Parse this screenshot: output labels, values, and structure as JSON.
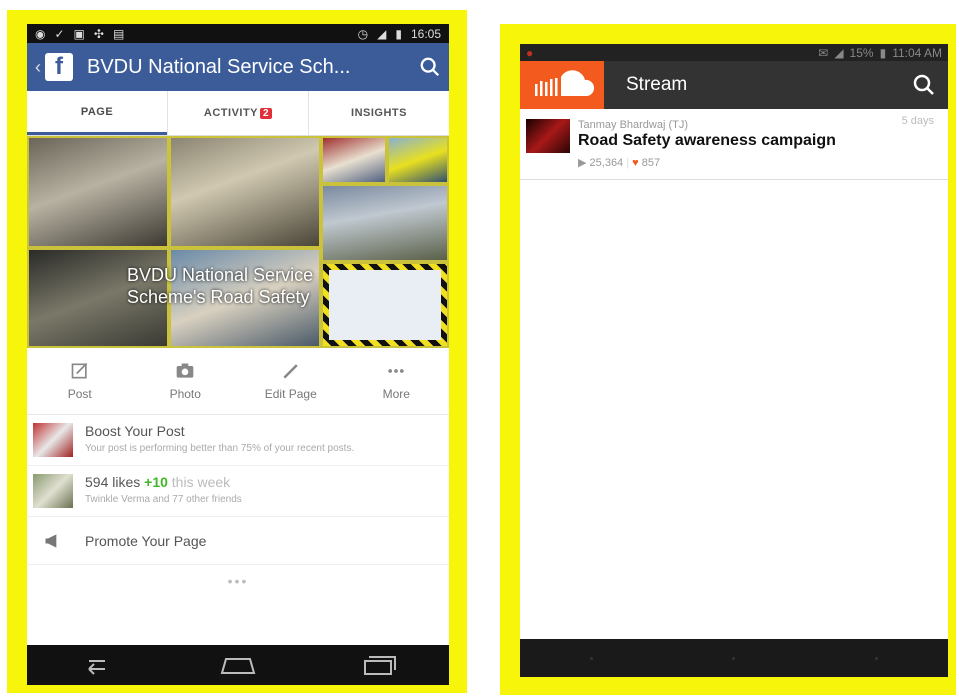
{
  "left_phone": {
    "status_bar": {
      "time": "16:05"
    },
    "header": {
      "title": "BVDU National Service Sch...",
      "search_icon": "search-icon"
    },
    "tabs": [
      {
        "label": "PAGE",
        "active": true
      },
      {
        "label": "ACTIVITY",
        "badge": "2",
        "active": false
      },
      {
        "label": "INSIGHTS",
        "active": false
      }
    ],
    "cover": {
      "overlay_text": "BVDU National Service Scheme's Road Safety"
    },
    "actions": [
      {
        "label": "Post",
        "icon": "compose-icon"
      },
      {
        "label": "Photo",
        "icon": "camera-icon"
      },
      {
        "label": "Edit Page",
        "icon": "pencil-icon"
      },
      {
        "label": "More",
        "icon": "more-dots-icon"
      }
    ],
    "boost": {
      "title": "Boost Your Post",
      "subtitle": "Your post is performing better than 75% of your recent posts."
    },
    "likes": {
      "count": "594 likes",
      "delta": "+10",
      "period": "this week",
      "friends": "Twinkle Verma and 77 other friends"
    },
    "promote": {
      "label": "Promote Your Page",
      "icon": "megaphone-icon"
    },
    "more_dots": "•••"
  },
  "right_phone": {
    "status_bar": {
      "battery": "15%",
      "time": "11:04 AM"
    },
    "header": {
      "title": "Stream",
      "logo": "soundcloud-logo",
      "search_icon": "search-icon"
    },
    "track": {
      "user": "Tanmay Bhardwaj (TJ)",
      "time": "5 days",
      "title": "Road Safety awareness campaign",
      "plays": "25,364",
      "likes": "857"
    }
  },
  "colors": {
    "frame": "#f7f50a",
    "facebook_blue": "#3b5b99",
    "soundcloud_orange": "#f35b1e"
  }
}
